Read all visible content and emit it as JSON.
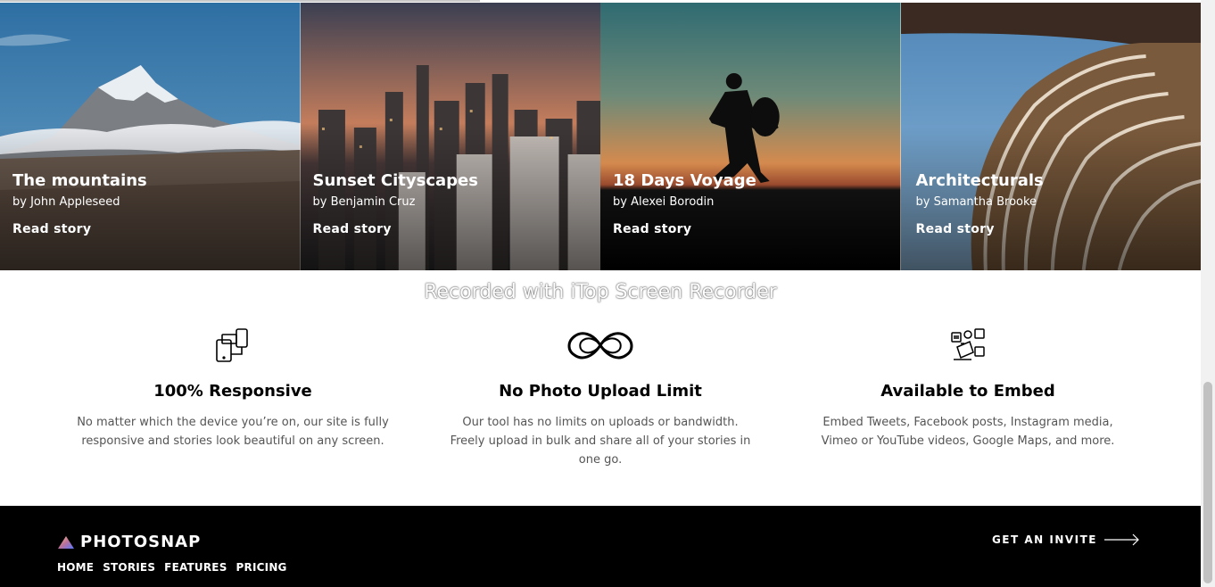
{
  "watermark": "Recorded with iTop Screen Recorder",
  "stories": [
    {
      "title": "The mountains",
      "author": "by John Appleseed",
      "cta": "Read story"
    },
    {
      "title": "Sunset Cityscapes",
      "author": "by Benjamin Cruz",
      "cta": "Read story"
    },
    {
      "title": "18 Days Voyage",
      "author": "by Alexei Borodin",
      "cta": "Read story"
    },
    {
      "title": "Architecturals",
      "author": "by Samantha Brooke",
      "cta": "Read story"
    }
  ],
  "features": [
    {
      "icon": "responsive-devices-icon",
      "title": "100% Responsive",
      "desc": "No matter which the device you’re on, our site is fully responsive and stories look beautiful on any screen."
    },
    {
      "icon": "infinity-icon",
      "title": "No Photo Upload Limit",
      "desc": "Our tool has no limits on uploads or bandwidth. Freely upload in bulk and share all of your stories in one go."
    },
    {
      "icon": "embed-media-icon",
      "title": "Available to Embed",
      "desc": "Embed Tweets, Facebook posts, Instagram media, Vimeo or YouTube videos, Google Maps, and more."
    }
  ],
  "footer": {
    "brand": "PHOTOSNAP",
    "nav": [
      "HOME",
      "STORIES",
      "FEATURES",
      "PRICING"
    ],
    "invite": "GET AN INVITE"
  },
  "colors": {
    "footer_bg": "#000000",
    "accent_gradient": [
      "#FFC593",
      "#BC7198",
      "#5A77FF"
    ]
  }
}
